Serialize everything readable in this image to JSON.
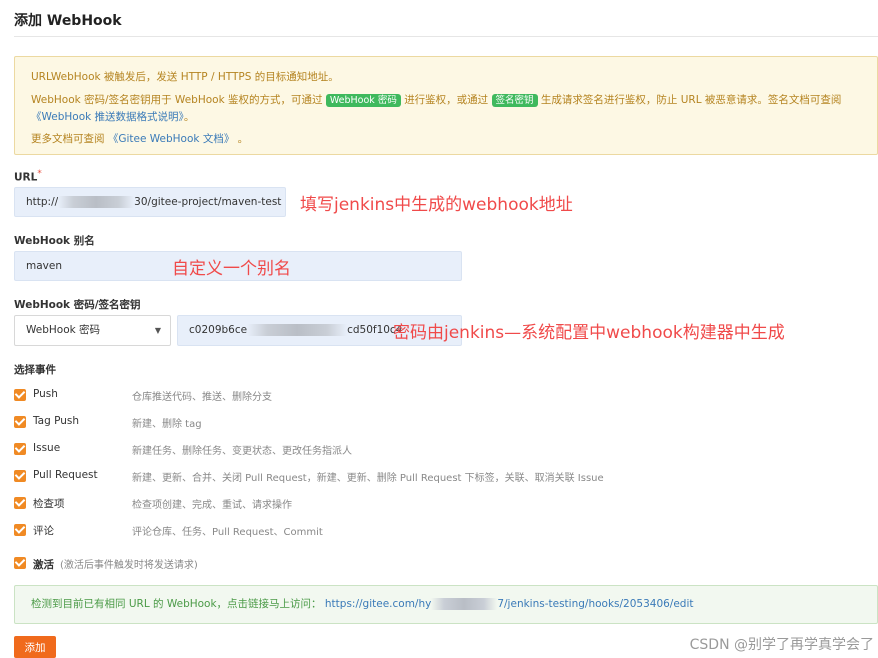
{
  "page": {
    "title": "添加 WebHook"
  },
  "notice": {
    "line1": "URLWebHook 被触发后，发送 HTTP / HTTPS 的目标通知地址。",
    "line2_a": "WebHook 密码/签名密钥用于 WebHook 鉴权的方式，可通过",
    "badge1": "WebHook 密码",
    "line2_b": "进行鉴权，或通过",
    "badge2": "签名密钥",
    "line2_c": "生成请求签名进行鉴权，防止 URL 被恶意请求。签名文档可查阅",
    "line3": "《WebHook 推送数据格式说明》",
    "line3_suffix": "。",
    "line4_a": "更多文档可查阅",
    "line4_link": "《Gitee WebHook 文档》",
    "line4_b": "。"
  },
  "url_field": {
    "label": "URL",
    "required_mark": "*",
    "value_prefix": "http://",
    "value_suffix": "30/gitee-project/maven-test",
    "annotation": "填写jenkins中生成的webhook地址"
  },
  "alias_field": {
    "label": "WebHook 别名",
    "value": "maven",
    "annotation": "自定义一个别名"
  },
  "secret_field": {
    "label": "WebHook 密码/签名密钥",
    "type_selected": "WebHook 密码",
    "value_prefix": "c0209b6ce",
    "value_suffix": "cd50f10c4",
    "annotation": "密码由jenkins—系统配置中webhook构建器中生成"
  },
  "events": {
    "label": "选择事件",
    "items": [
      {
        "name": "Push",
        "desc": "仓库推送代码、推送、删除分支"
      },
      {
        "name": "Tag Push",
        "desc": "新建、删除 tag"
      },
      {
        "name": "Issue",
        "desc": "新建任务、删除任务、变更状态、更改任务指派人"
      },
      {
        "name": "Pull Request",
        "desc": "新建、更新、合并、关闭 Pull Request，新建、更新、删除 Pull Request 下标签，关联、取消关联 Issue"
      },
      {
        "name": "检查项",
        "desc": "检查项创建、完成、重试、请求操作"
      },
      {
        "name": "评论",
        "desc": "评论仓库、任务、Pull Request、Commit"
      }
    ]
  },
  "activate": {
    "label": "激活",
    "hint": "(激活后事件触发时将发送请求)"
  },
  "success_msg": {
    "text": "检测到目前已有相同 URL 的 WebHook，点击链接马上访问：",
    "url_prefix": "https://gitee.com/hy",
    "url_suffix": "7/jenkins-testing/hooks/2053406/edit"
  },
  "submit": {
    "label": "添加"
  },
  "watermark": "CSDN @别学了再学真学会了"
}
